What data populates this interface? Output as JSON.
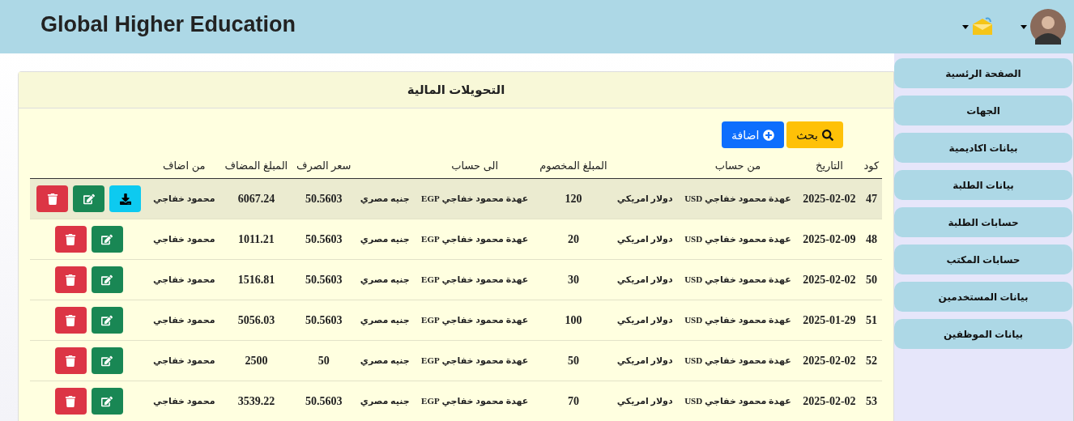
{
  "header": {
    "title": "Global Higher Education"
  },
  "sidebar": {
    "items": [
      {
        "label": "الصفحة الرئسية"
      },
      {
        "label": "الجهات"
      },
      {
        "label": "بيانات اكاديمية"
      },
      {
        "label": "بيانات الطلبة"
      },
      {
        "label": "حسابات الطلبة"
      },
      {
        "label": "حسابات المكتب"
      },
      {
        "label": "بيانات المستخدمين"
      },
      {
        "label": "بيانات الموظفين"
      }
    ]
  },
  "card": {
    "title": "التحويلات المالية",
    "buttons": [
      {
        "kind": "search",
        "label": "بحث"
      },
      {
        "kind": "add",
        "label": "اضافة"
      }
    ],
    "table": {
      "columns": {
        "code": "كود",
        "date": "التاريخ",
        "from_account": "من حساب",
        "deducted": "المبلغ المخصوم",
        "to_account": "الى حساب",
        "rate": "سعر الصرف",
        "added": "المبلغ المضاف",
        "added_by": "من اضاف"
      },
      "rows": [
        {
          "selected": true,
          "code": "47",
          "date": "2025-02-02",
          "from_account": "عهدة محمود خفاجي USD",
          "from_currency": "دولار امريكي",
          "deducted": "120",
          "to_account": "عهدة محمود خفاجي EGP",
          "to_currency": "جنيه مصري",
          "rate": "50.5603",
          "added": "6067.24",
          "added_by": "محمود خفاجي",
          "actions": [
            {
              "kind": "delete"
            },
            {
              "kind": "edit"
            },
            {
              "kind": "download"
            }
          ]
        },
        {
          "selected": false,
          "code": "48",
          "date": "2025-02-09",
          "from_account": "عهدة محمود خفاجي USD",
          "from_currency": "دولار امريكي",
          "deducted": "20",
          "to_account": "عهدة محمود خفاجي EGP",
          "to_currency": "جنيه مصري",
          "rate": "50.5603",
          "added": "1011.21",
          "added_by": "محمود خفاجي",
          "actions": [
            {
              "kind": "delete"
            },
            {
              "kind": "edit"
            }
          ]
        },
        {
          "selected": false,
          "code": "50",
          "date": "2025-02-02",
          "from_account": "عهدة محمود خفاجي USD",
          "from_currency": "دولار امريكي",
          "deducted": "30",
          "to_account": "عهدة محمود خفاجي EGP",
          "to_currency": "جنيه مصري",
          "rate": "50.5603",
          "added": "1516.81",
          "added_by": "محمود خفاجي",
          "actions": [
            {
              "kind": "delete"
            },
            {
              "kind": "edit"
            }
          ]
        },
        {
          "selected": false,
          "code": "51",
          "date": "2025-01-29",
          "from_account": "عهدة محمود خفاجي USD",
          "from_currency": "دولار امريكي",
          "deducted": "100",
          "to_account": "عهدة محمود خفاجي EGP",
          "to_currency": "جنيه مصري",
          "rate": "50.5603",
          "added": "5056.03",
          "added_by": "محمود خفاجي",
          "actions": [
            {
              "kind": "delete"
            },
            {
              "kind": "edit"
            }
          ]
        },
        {
          "selected": false,
          "code": "52",
          "date": "2025-02-02",
          "from_account": "عهدة محمود خفاجي USD",
          "from_currency": "دولار امريكي",
          "deducted": "50",
          "to_account": "عهدة محمود خفاجي EGP",
          "to_currency": "جنيه مصري",
          "rate": "50",
          "added": "2500",
          "added_by": "محمود خفاجي",
          "actions": [
            {
              "kind": "delete"
            },
            {
              "kind": "edit"
            }
          ]
        },
        {
          "selected": false,
          "code": "53",
          "date": "2025-02-02",
          "from_account": "عهدة محمود خفاجي USD",
          "from_currency": "دولار امريكي",
          "deducted": "70",
          "to_account": "عهدة محمود خفاجي EGP",
          "to_currency": "جنيه مصري",
          "rate": "50.5603",
          "added": "3539.22",
          "added_by": "محمود خفاجي",
          "actions": [
            {
              "kind": "delete"
            },
            {
              "kind": "edit"
            }
          ]
        }
      ]
    }
  }
}
